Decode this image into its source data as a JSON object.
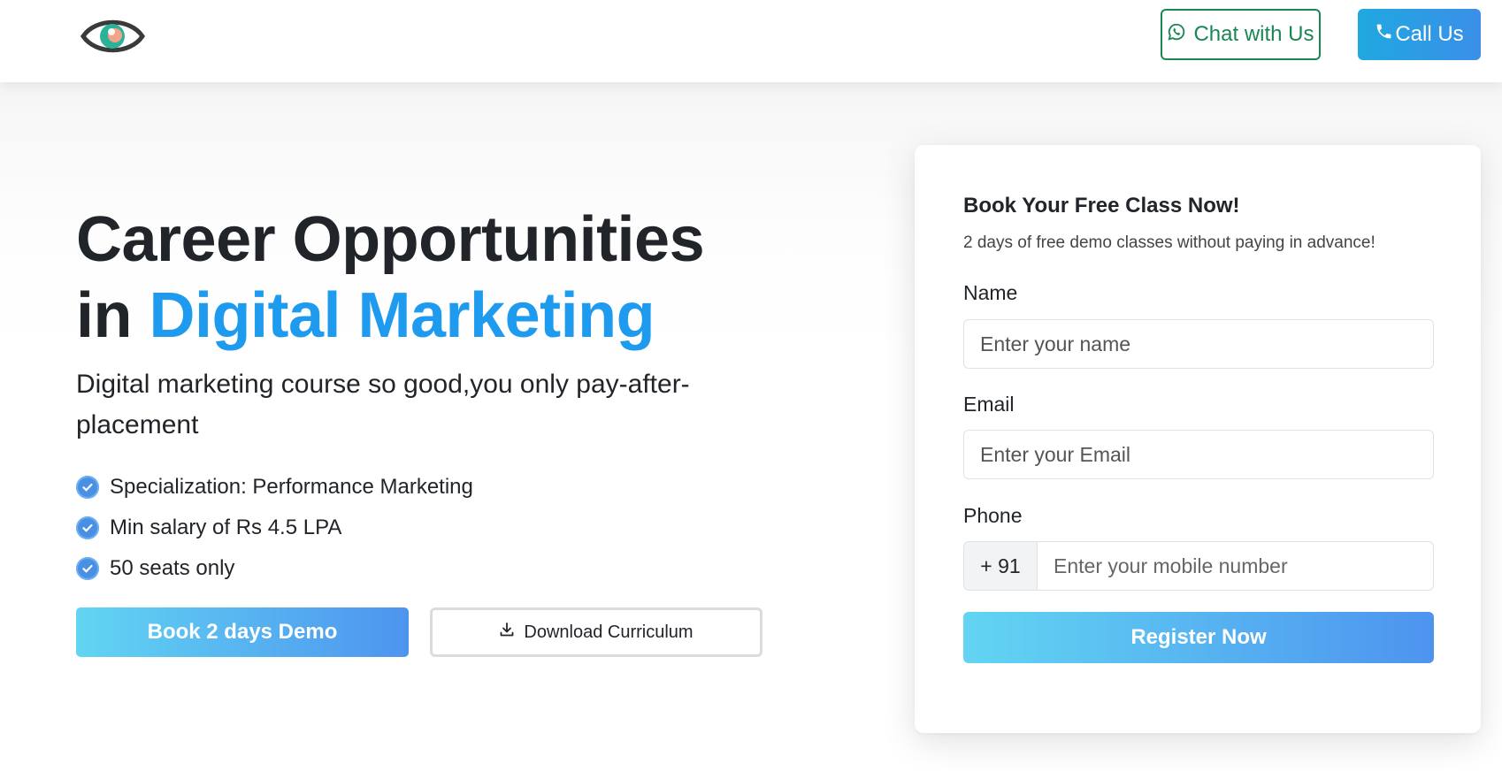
{
  "header": {
    "logo_icon": "eye-logo-icon",
    "chat_button": {
      "label": "Chat with Us",
      "icon": "whatsapp-icon",
      "color": "#198754"
    },
    "call_button": {
      "label": "Call Us",
      "icon": "phone-icon",
      "color": "#1fa8e0"
    }
  },
  "hero": {
    "title_line1": "Career Opportunities",
    "title_line2_prefix": "in",
    "title_line2_accent": "Digital Marketing",
    "accent_color": "#1e9bef",
    "subtitle": "Digital marketing course so good,you only pay-after-placement",
    "features": [
      {
        "icon": "check-circle-icon",
        "text": "Specialization: Performance Marketing"
      },
      {
        "icon": "check-circle-icon",
        "text": "Min salary of Rs 4.5 LPA"
      },
      {
        "icon": "check-circle-icon",
        "text": "50 seats only"
      }
    ],
    "demo_button": "Book 2 days Demo",
    "download_button": {
      "label": "Download Curriculum",
      "icon": "download-icon"
    }
  },
  "form": {
    "title": "Book Your Free Class Now!",
    "subtitle": "2 days of free demo classes without paying in advance!",
    "name_label": "Name",
    "name_placeholder": "Enter your name",
    "email_label": "Email",
    "email_placeholder": "Enter your Email",
    "phone_label": "Phone",
    "phone_prefix": "+ 91",
    "phone_placeholder": "Enter your mobile number",
    "submit_button": "Register Now"
  }
}
